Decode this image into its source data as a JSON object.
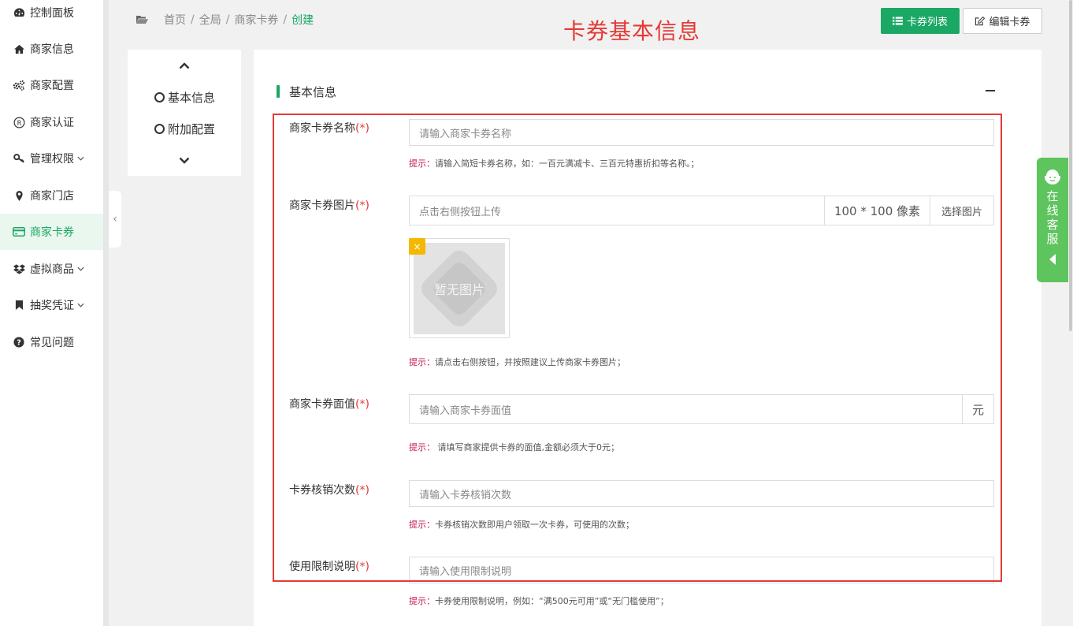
{
  "sidebar": {
    "items": [
      {
        "label": "控制面板",
        "icon": "dashboard-icon",
        "chevron": false,
        "active": false
      },
      {
        "label": "商家信息",
        "icon": "home-icon",
        "chevron": false,
        "active": false
      },
      {
        "label": "商家配置",
        "icon": "gears-icon",
        "chevron": false,
        "active": false
      },
      {
        "label": "商家认证",
        "icon": "registered-icon",
        "chevron": false,
        "active": false
      },
      {
        "label": "管理权限",
        "icon": "key-icon",
        "chevron": true,
        "active": false
      },
      {
        "label": "商家门店",
        "icon": "map-pin-icon",
        "chevron": false,
        "active": false
      },
      {
        "label": "商家卡券",
        "icon": "credit-card-icon",
        "chevron": false,
        "active": true
      },
      {
        "label": "虚拟商品",
        "icon": "dropbox-icon",
        "chevron": true,
        "active": false
      },
      {
        "label": "抽奖凭证",
        "icon": "bookmark-icon",
        "chevron": true,
        "active": false
      },
      {
        "label": "常见问题",
        "icon": "question-circle-icon",
        "chevron": false,
        "active": false
      }
    ],
    "collapse_glyph": "‹"
  },
  "breadcrumb": {
    "items": [
      "首页",
      "全局",
      "商家卡券"
    ],
    "separator": "/",
    "current": "创建"
  },
  "toolbar": {
    "list_button": "卡券列表",
    "edit_button": "编辑卡券"
  },
  "annotation": {
    "title": "卡券基本信息"
  },
  "steps": {
    "items": [
      "基本信息",
      "附加配置"
    ]
  },
  "section": {
    "title": "基本信息"
  },
  "form": {
    "required_mark": "(*)",
    "hint_key": "提示：",
    "name": {
      "label": "商家卡券名称",
      "placeholder": "请输入商家卡券名称",
      "hint": "请输入简短卡券名称，如：一百元满减卡、三百元特惠折扣等名称。；"
    },
    "image": {
      "label": "商家卡券图片",
      "placeholder": "点击右侧按钮上传",
      "size": "100 * 100 像素",
      "choose": "选择图片",
      "empty": "暂无图片",
      "remove": "×",
      "hint": "请点击右侧按钮，并按照建议上传商家卡券图片；"
    },
    "value": {
      "label": "商家卡券面值",
      "placeholder": "请输入商家卡券面值",
      "unit": "元",
      "hint": " 请填写商家提供卡券的面值,金额必须大于0元；"
    },
    "count": {
      "label": "卡券核销次数",
      "placeholder": "请输入卡券核销次数",
      "hint": "卡券核销次数即用户领取一次卡券，可使用的次数；"
    },
    "limit": {
      "label": "使用限制说明",
      "placeholder": "请输入使用限制说明",
      "hint": "卡券使用限制说明，例如：“满500元可用”或“无门槛使用”；"
    }
  },
  "service": {
    "text": "在线客服"
  },
  "colors": {
    "primary": "#1ba864",
    "annotation": "#e53935",
    "hint_key": "#c2185b",
    "service": "#5ec45e"
  }
}
